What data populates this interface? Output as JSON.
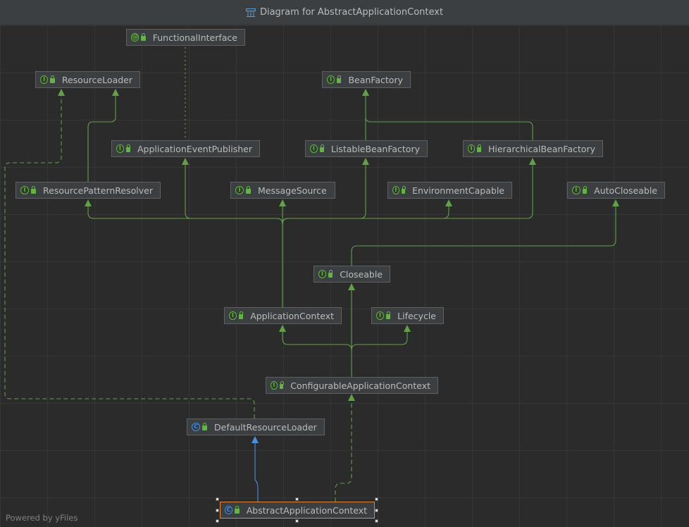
{
  "window": {
    "title": "Diagram for AbstractApplicationContext"
  },
  "footer": {
    "powered_by": "Powered by yFiles"
  },
  "colors": {
    "background": "#2b2b2b",
    "node_fill": "#3c3f41",
    "node_border": "#5e6060",
    "text": "#bbbbbb",
    "interface_edge": "#62a04a",
    "class_edge": "#4d90e0",
    "selection_border": "#e0883c"
  },
  "nodes": [
    {
      "id": "functional_interface",
      "kind": "annotation",
      "icon": "annotation-icon",
      "label": "FunctionalInterface"
    },
    {
      "id": "resource_loader",
      "kind": "interface",
      "icon": "interface-icon",
      "label": "ResourceLoader"
    },
    {
      "id": "bean_factory",
      "kind": "interface",
      "icon": "interface-icon",
      "label": "BeanFactory"
    },
    {
      "id": "application_event_publisher",
      "kind": "interface",
      "icon": "interface-icon",
      "label": "ApplicationEventPublisher"
    },
    {
      "id": "listable_bean_factory",
      "kind": "interface",
      "icon": "interface-icon",
      "label": "ListableBeanFactory"
    },
    {
      "id": "hierarchical_bean_factory",
      "kind": "interface",
      "icon": "interface-icon",
      "label": "HierarchicalBeanFactory"
    },
    {
      "id": "resource_pattern_resolver",
      "kind": "interface",
      "icon": "interface-icon",
      "label": "ResourcePatternResolver"
    },
    {
      "id": "message_source",
      "kind": "interface",
      "icon": "interface-icon",
      "label": "MessageSource"
    },
    {
      "id": "environment_capable",
      "kind": "interface",
      "icon": "interface-icon",
      "label": "EnvironmentCapable"
    },
    {
      "id": "auto_closeable",
      "kind": "interface",
      "icon": "interface-icon",
      "label": "AutoCloseable"
    },
    {
      "id": "closeable",
      "kind": "interface",
      "icon": "interface-icon",
      "label": "Closeable"
    },
    {
      "id": "application_context",
      "kind": "interface",
      "icon": "interface-icon",
      "label": "ApplicationContext"
    },
    {
      "id": "lifecycle",
      "kind": "interface",
      "icon": "interface-icon",
      "label": "Lifecycle"
    },
    {
      "id": "configurable_application_context",
      "kind": "interface",
      "icon": "interface-icon",
      "label": "ConfigurableApplicationContext"
    },
    {
      "id": "default_resource_loader",
      "kind": "class",
      "icon": "class-icon",
      "label": "DefaultResourceLoader"
    },
    {
      "id": "abstract_application_context",
      "kind": "class",
      "icon": "abstract-class-icon",
      "label": "AbstractApplicationContext",
      "selected": true
    }
  ]
}
